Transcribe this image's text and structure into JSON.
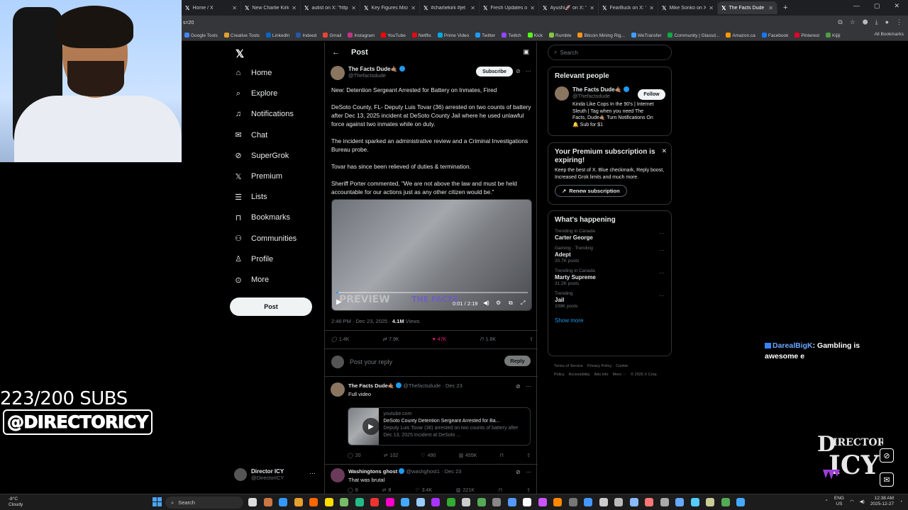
{
  "browser": {
    "tabs": [
      {
        "label": "Home / X",
        "active": false
      },
      {
        "label": "New Charlie Kirk sh",
        "active": false
      },
      {
        "label": "autist on X: \"https:/",
        "active": false
      },
      {
        "label": "Key Figures Missing",
        "active": false
      },
      {
        "label": "#charliekirk #jet",
        "active": false
      },
      {
        "label": "Fresh Updates on X",
        "active": false
      },
      {
        "label": "Ayushi🚀 on X: \"Yo",
        "active": false
      },
      {
        "label": "FearBuck on X: \"A T",
        "active": false
      },
      {
        "label": "Mike Sonko on X: \"T",
        "active": false
      },
      {
        "label": "The Facts Dude",
        "active": true
      }
    ],
    "address_fragment": "s=20",
    "bookmarks": [
      "Google Tools",
      "Creative Tools",
      "LinkedIn",
      "Indeed",
      "Gmail",
      "Instagram",
      "YouTube",
      "Netflix",
      "Prime Video",
      "Twitter",
      "Twitch",
      "Kick",
      "Rumble",
      "Bitcoin Mining Rig...",
      "WeTransfer",
      "Community | Glassd...",
      "Amazon.ca",
      "Facebook",
      "Pinterest",
      "Kijiji"
    ],
    "all_bookmarks": "All Bookmarks",
    "accent": "#1d9bf0"
  },
  "overlay": {
    "subs_count": "223/200 SUBS",
    "subs_handle": "@DIRECTORICY",
    "chat_user": "DarealBigK",
    "chat_text": ": Gambling is awesome e",
    "logo_text": "DIRECTOR ICY"
  },
  "nav": {
    "items": [
      "Home",
      "Explore",
      "Notifications",
      "Chat",
      "SuperGrok",
      "Premium",
      "Lists",
      "Bookmarks",
      "Communities",
      "Profile",
      "More"
    ],
    "icons": [
      "home-icon",
      "search-icon",
      "bell-icon",
      "chat-icon",
      "grok-icon",
      "x-icon",
      "list-icon",
      "bookmark-icon",
      "communities-icon",
      "profile-icon",
      "more-icon"
    ],
    "post_button": "Post",
    "account_name": "Director ICY",
    "account_handle": "@DirectorICY"
  },
  "post": {
    "header": "Post",
    "author_name": "The Facts Dude🤙🏽",
    "author_handle": "@Thefactsdude",
    "subscribe": "Subscribe",
    "p1": "New: Detention Sergeant Arrested for Battery on Inmates, Fired",
    "p2": "DeSoto County, FL- Deputy Luis Tovar (36) arrested on two counts of battery after Dec 13, 2025 incident at DeSoto County Jail where he used unlawful force against two inmates while on duty.",
    "p3": "The incident sparked an administrative review and a  Criminal Investigations Bureau probe.",
    "p4": "Tovar has since been relieved of duties & termination.",
    "p5": "Sheriff Porter commented, \"We are not above the law and must be held accountable for our actions just as any other citizen would be.\"",
    "video_preview": "PREVIEW",
    "video_watermark": "THE FACTS",
    "video_time": "0:01 / 2:19",
    "video_progress": 0.01,
    "time": "2:46 PM · Dec 23, 2025 · ",
    "views": "4.1M",
    "views_label": " Views",
    "stats": {
      "replies": "1.4K",
      "reposts": "7.9K",
      "likes": "47K",
      "bookmarks": "1.8K"
    },
    "reply_placeholder": "Post your reply",
    "reply_button": "Reply"
  },
  "replies": [
    {
      "name": "The Facts Dude🤙🏽",
      "meta": "@Thefactsdude · Dec 23",
      "text": "Full video",
      "card_domain": "youtube.com",
      "card_title": "DeSoto County Detention Sergeant Arrested for Ba...",
      "card_desc": "Deputy Luis Tovar (36) arrested on two counts of battery after Dec 13, 2025 Incident at DeSoto ...",
      "stats": {
        "replies": "20",
        "reposts": "102",
        "likes": "490",
        "views": "455K"
      }
    },
    {
      "name": "Washingtons ghost",
      "meta": "@washghost1 · Dec 23",
      "text": "That was brutal",
      "stats": {
        "replies": "8",
        "reposts": "8",
        "likes": "3.4K",
        "views": "221K"
      }
    }
  ],
  "right": {
    "search_placeholder": "Search",
    "relevant_title": "Relevant people",
    "person_name": "The Facts Dude🤙🏽",
    "person_handle": "@Thefactsdude",
    "person_bio": "Kinda Like Cops In the 90's | Internet Sleuth | Tag when you need The Facts, Dude🤙🏽 Turn Notifications On 🔔 Sub for $1",
    "follow": "Follow",
    "premium_title": "Your Premium subscription is expiring!",
    "premium_text": "Keep the best of X. Blue checkmark, Reply boost, Increased Grok limits and much more.",
    "renew": "Renew subscription",
    "happening_title": "What's happening",
    "trends": [
      {
        "cat": "Trending in Canada",
        "name": "Carter George",
        "count": ""
      },
      {
        "cat": "Gaming · Trending",
        "name": "Adept",
        "count": "20.7K posts"
      },
      {
        "cat": "Trending in Canada",
        "name": "Marty Supreme",
        "count": "31.2K posts"
      },
      {
        "cat": "Trending",
        "name": "Jail",
        "count": "108K posts"
      }
    ],
    "show_more": "Show more",
    "footer": [
      "Terms of Service",
      "Privacy Policy",
      "Cookie Policy",
      "Accessibility",
      "Ads info",
      "More ···",
      "© 2025 X Corp."
    ]
  },
  "taskbar": {
    "temp": "-8°C",
    "condition": "Cloudy",
    "search": "Search",
    "lang1": "ENG",
    "lang2": "US",
    "time": "12:38 AM",
    "date": "2025-12-27"
  }
}
